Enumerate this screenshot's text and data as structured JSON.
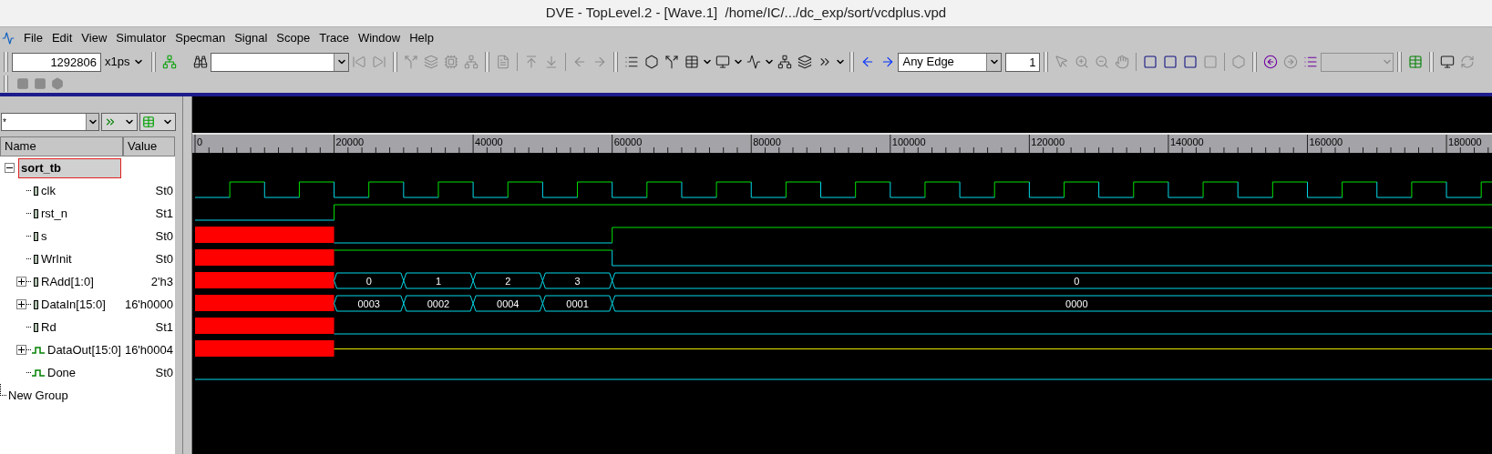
{
  "window": {
    "title": "DVE - TopLevel.2 - [Wave.1]  /home/IC/.../dc_exp/sort/vcdplus.vpd"
  },
  "menu": [
    "File",
    "Edit",
    "View",
    "Simulator",
    "Specman",
    "Signal",
    "Scope",
    "Trace",
    "Window",
    "Help"
  ],
  "toolbar": {
    "time": "1292806",
    "unit": "x1ps",
    "edge": "Any Edge",
    "count": "1"
  },
  "signal_filter": {
    "value": "*"
  },
  "columns": [
    "Name",
    "Value"
  ],
  "tree": [
    {
      "name": "sort_tb",
      "kind": "scope",
      "selected": true,
      "expanded": true,
      "children": [
        {
          "name": "clk",
          "value": "St0",
          "kind": "clock"
        },
        {
          "name": "rst_n",
          "value": "St1",
          "kind": "reg",
          "wave": [
            {
              "kind": "low"
            },
            {
              "kind": "same"
            },
            {
              "kind": "high"
            }
          ]
        },
        {
          "name": "s",
          "value": "St0",
          "kind": "reg",
          "wave": [
            {
              "kind": "unknown"
            },
            {
              "kind": "same"
            },
            {
              "kind": "low"
            },
            {
              "kind": "same"
            },
            {
              "kind": "same"
            },
            {
              "kind": "same"
            },
            {
              "kind": "high"
            }
          ]
        },
        {
          "name": "WrInit",
          "value": "St0",
          "kind": "reg",
          "wave": [
            {
              "kind": "unknown"
            },
            {
              "kind": "same"
            },
            {
              "kind": "high"
            },
            {
              "kind": "same"
            },
            {
              "kind": "same"
            },
            {
              "kind": "same"
            },
            {
              "kind": "low"
            }
          ]
        },
        {
          "name": "RAdd[1:0]",
          "value": "2'h3",
          "kind": "reg",
          "expanded": false,
          "wave": [
            {
              "kind": "unknown"
            },
            {
              "kind": "same"
            },
            {
              "kind": "bus",
              "value": "0"
            },
            {
              "kind": "bus",
              "value": "1"
            },
            {
              "kind": "bus",
              "value": "2"
            },
            {
              "kind": "bus",
              "value": "3"
            },
            {
              "kind": "bus",
              "value": "0"
            }
          ]
        },
        {
          "name": "DataIn[15:0]",
          "value": "16'h0000",
          "kind": "reg",
          "expanded": false,
          "wave": [
            {
              "kind": "unknown"
            },
            {
              "kind": "same"
            },
            {
              "kind": "bus",
              "value": "0003"
            },
            {
              "kind": "bus",
              "value": "0002"
            },
            {
              "kind": "bus",
              "value": "0004"
            },
            {
              "kind": "bus",
              "value": "0001"
            },
            {
              "kind": "bus",
              "value": "0000"
            }
          ]
        },
        {
          "name": "Rd",
          "value": "St1",
          "kind": "reg",
          "wave": [
            {
              "kind": "unknown"
            },
            {
              "kind": "same"
            },
            {
              "kind": "low"
            }
          ]
        },
        {
          "name": "DataOut[15:0]",
          "value": "16'h0004",
          "kind": "wire",
          "expanded": false,
          "wave": [
            {
              "kind": "unknown"
            },
            {
              "kind": "same"
            },
            {
              "kind": "float"
            }
          ]
        },
        {
          "name": "Done",
          "value": "St0",
          "kind": "wire",
          "wave": [
            {
              "kind": "low"
            }
          ]
        }
      ]
    },
    {
      "name": "New Group",
      "kind": "group"
    }
  ],
  "ruler": [
    "0",
    "20000",
    "40000",
    "60000",
    "80000",
    "100000",
    "120000",
    "140000",
    "160000",
    "180000"
  ]
}
